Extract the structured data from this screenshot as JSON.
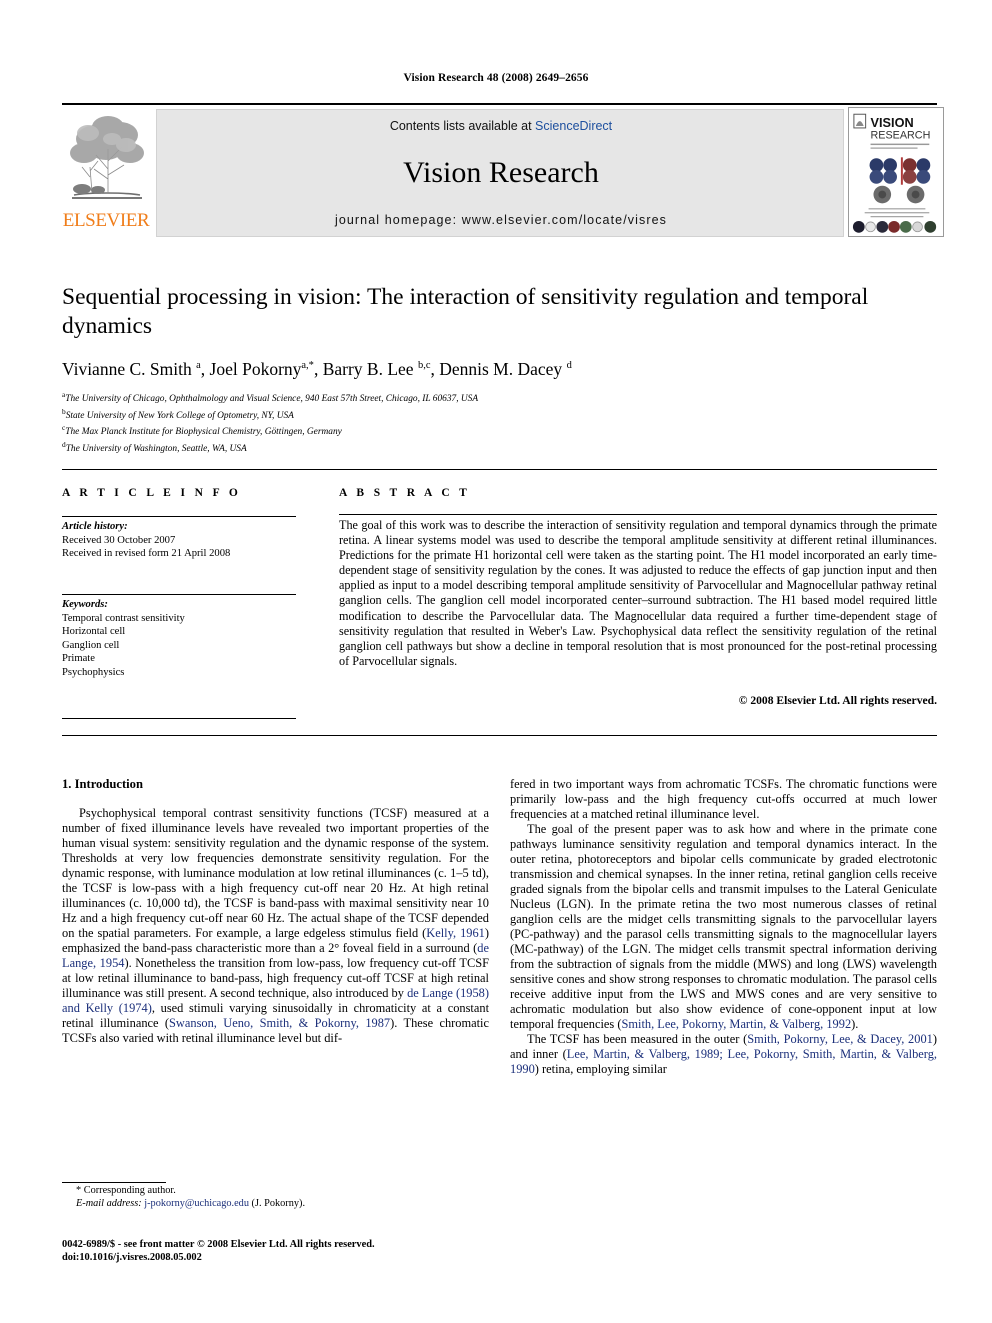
{
  "running_head": "Vision Research 48 (2008) 2649–2656",
  "masthead": {
    "publisher_name": "ELSEVIER",
    "contents_prefix": "Contents lists available at ",
    "contents_link": "ScienceDirect",
    "journal_name": "Vision Research",
    "homepage": "journal homepage: www.elsevier.com/locate/visres",
    "cover_title_line1": "VISION",
    "cover_title_line2": "RESEARCH"
  },
  "article": {
    "title": "Sequential processing in vision: The interaction of sensitivity regulation and temporal dynamics",
    "authors_html": "Vivianne C. Smith <sup>a</sup>, Joel Pokorny<sup>a,*</sup>, Barry B. Lee <sup>b,c</sup>, Dennis M. Dacey <sup>d</sup>",
    "affiliations": [
      {
        "marker": "a",
        "text": "The University of Chicago, Ophthalmology and Visual Science, 940 East 57th Street, Chicago, IL 60637, USA"
      },
      {
        "marker": "b",
        "text": "State University of New York College of Optometry, NY, USA"
      },
      {
        "marker": "c",
        "text": "The Max Planck Institute for Biophysical Chemistry, Göttingen, Germany"
      },
      {
        "marker": "d",
        "text": "The University of Washington, Seattle, WA, USA"
      }
    ]
  },
  "info": {
    "article_info_heading": "A R T I C L E   I N F O",
    "abstract_heading": "A B S T R A C T",
    "history_label": "Article history:",
    "history_lines": [
      "Received 30 October 2007",
      "Received in revised form 21 April 2008"
    ],
    "keywords_label": "Keywords:",
    "keywords": [
      "Temporal contrast sensitivity",
      "Horizontal cell",
      "Ganglion cell",
      "Primate",
      "Psychophysics"
    ]
  },
  "abstract": {
    "text": "The goal of this work was to describe the interaction of sensitivity regulation and temporal dynamics through the primate retina. A linear systems model was used to describe the temporal amplitude sensitivity at different retinal illuminances. Predictions for the primate H1 horizontal cell were taken as the starting point. The H1 model incorporated an early time-dependent stage of sensitivity regulation by the cones. It was adjusted to reduce the effects of gap junction input and then applied as input to a model describing temporal amplitude sensitivity of Parvocellular and Magnocellular pathway retinal ganglion cells. The ganglion cell model incorporated center–surround subtraction. The H1 based model required little modification to describe the Parvocellular data. The Magnocellular data required a further time-dependent stage of sensitivity regulation that resulted in Weber's Law. Psychophysical data reflect the sensitivity regulation of the retinal ganglion cell pathways but show a decline in temporal resolution that is most pronounced for the post-retinal processing of Parvocellular signals.",
    "copyright": "© 2008 Elsevier Ltd. All rights reserved."
  },
  "body": {
    "section_heading": "1. Introduction",
    "left_paragraph_1_html": "Psychophysical temporal contrast sensitivity functions (TCSF) measured at a number of fixed illuminance levels have revealed two important properties of the human visual system: sensitivity regulation and the dynamic response of the system. Thresholds at very low frequencies demonstrate sensitivity regulation. For the dynamic response, with luminance modulation at low retinal illuminances (c. 1–5 td), the TCSF is low-pass with a high frequency cut-off near 20 Hz. At high retinal illuminances (c. 10,000 td), the TCSF is band-pass with maximal sensitivity near 10 Hz and a high frequency cut-off near 60 Hz. The actual shape of the TCSF depended on the spatial parameters. For example, a large edgeless stimulus field (<span class=\"cite\">Kelly, 1961</span>) emphasized the band-pass characteristic more than a 2° foveal field in a surround (<span class=\"cite\">de Lange, 1954</span>). Nonetheless the transition from low-pass, low frequency cut-off TCSF at low retinal illuminance to band-pass, high frequency cut-off TCSF at high retinal illuminance was still present. A second technique, also introduced by <span class=\"cite\">de Lange (1958) and Kelly (1974)</span>, used stimuli varying sinusoidally in chromaticity at a constant retinal illuminance (<span class=\"cite\">Swanson, Ueno, Smith, &amp; Pokorny, 1987</span>). These chromatic TCSFs also varied with retinal illuminance level but dif-",
    "right_paragraph_1_html": "fered in two important ways from achromatic TCSFs. The chromatic functions were primarily low-pass and the high frequency cut-offs occurred at much lower frequencies at a matched retinal illuminance level.",
    "right_paragraph_2_html": "The goal of the present paper was to ask how and where in the primate cone pathways luminance sensitivity regulation and temporal dynamics interact. In the outer retina, photoreceptors and bipolar cells communicate by graded electrotonic transmission and chemical synapses. In the inner retina, retinal ganglion cells receive graded signals from the bipolar cells and transmit impulses to the Lateral Geniculate Nucleus (LGN). In the primate retina the two most numerous classes of retinal ganglion cells are the midget cells transmitting signals to the parvocellular layers (PC-pathway) and the parasol cells transmitting signals to the magnocellular layers (MC-pathway) of the LGN. The midget cells transmit spectral information deriving from the subtraction of signals from the middle (MWS) and long (LWS) wavelength sensitive cones and show strong responses to chromatic modulation. The parasol cells receive additive input from the LWS and MWS cones and are very sensitive to achromatic modulation but also show evidence of cone-opponent input at low temporal frequencies (<span class=\"cite\">Smith, Lee, Pokorny, Martin, &amp; Valberg, 1992</span>).",
    "right_paragraph_3_html": "The TCSF has been measured in the outer (<span class=\"cite\">Smith, Pokorny, Lee, &amp; Dacey, 2001</span>) and inner (<span class=\"cite\">Lee, Martin, &amp; Valberg, 1989; Lee, Pokorny, Smith, Martin, &amp; Valberg, 1990</span>) retina, employing similar"
  },
  "footnote": {
    "corresponding": "* Corresponding author.",
    "email_label": "E-mail address:",
    "email": "j-pokorny@uchicago.edu",
    "email_suffix": "(J. Pokorny).",
    "imprint_line1": "0042-6989/$ - see front matter © 2008 Elsevier Ltd. All rights reserved.",
    "imprint_line2": "doi:10.1016/j.visres.2008.05.002"
  },
  "colors": {
    "link_blue": "#1d4f9e",
    "citation_blue": "#1b2f7a",
    "elsevier_orange": "#F07D1A",
    "banner_gray": "#e6e6e6"
  }
}
